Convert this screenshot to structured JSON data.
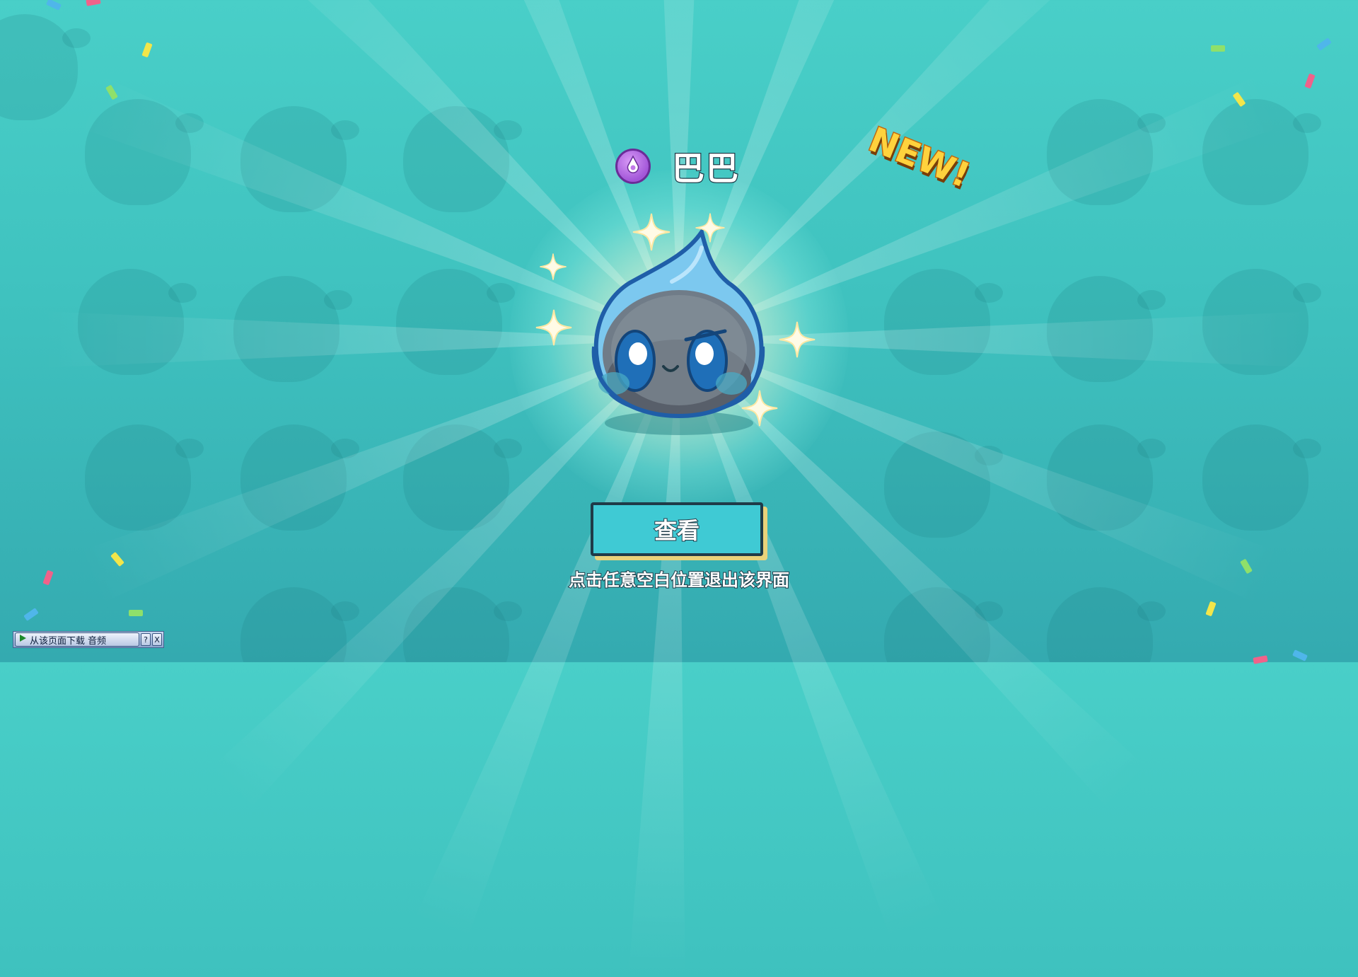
{
  "pet": {
    "name": "巴巴",
    "badge_text": "NEW!",
    "element": "water-drop-pet",
    "element_icon": "purple-element-icon"
  },
  "view_button": {
    "label": "查看"
  },
  "hint_text": "点击任意空白位置退出该界面",
  "audio_toolbar": {
    "download_label": "从该页面下载 音频",
    "help_label": "?",
    "close_label": "X",
    "play_icon": "play-icon"
  },
  "colors": {
    "background": "#41c4c0",
    "button": "#3fcad4",
    "outline": "#1f3b48",
    "new_badge": "#ffd23d",
    "element_badge": "#a256d8"
  }
}
